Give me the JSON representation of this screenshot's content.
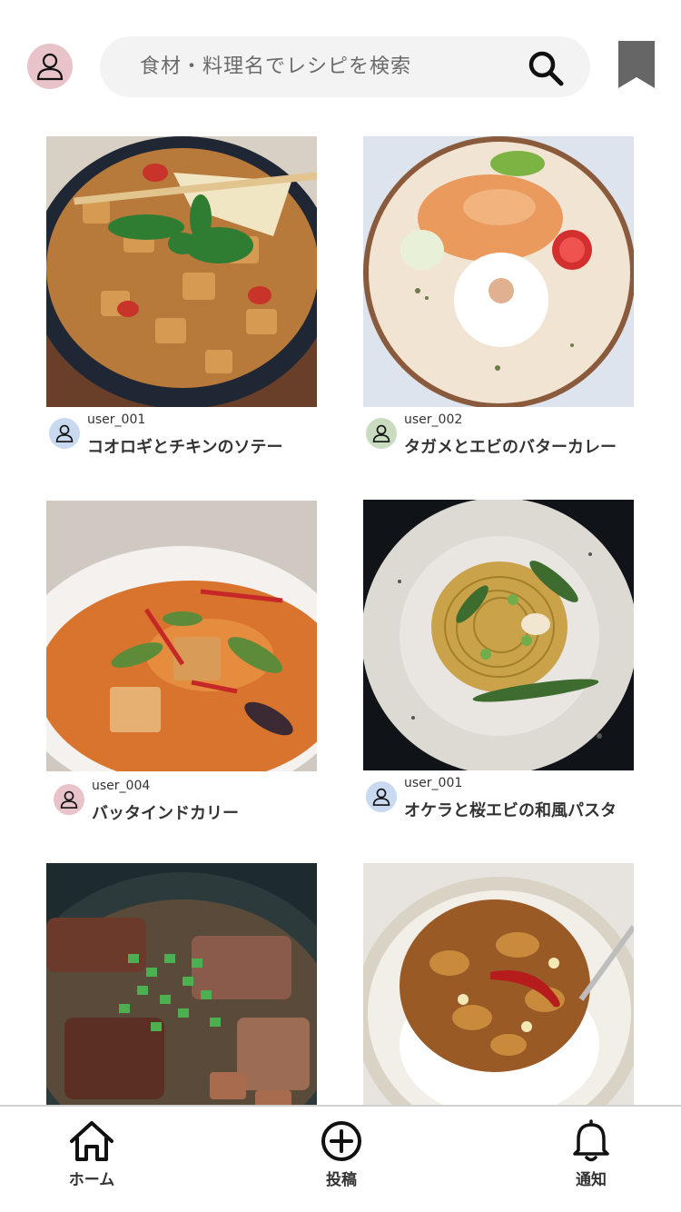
{
  "header": {
    "search_placeholder": "食材・料理名でレシピを検索",
    "avatar_icon": "user-icon",
    "search_icon": "search-icon",
    "bookmark_icon": "bookmark-icon",
    "avatar_color": "#e8c4ca",
    "bookmark_color": "#666666"
  },
  "posts": [
    {
      "user": "user_001",
      "title": "コオロギとチキンのソテー",
      "avatar_color": "#c9d9ef"
    },
    {
      "user": "user_002",
      "title": "タガメとエビのバターカレー",
      "avatar_color": "#c9dcc0"
    },
    {
      "user": "user_004",
      "title": "バッタインドカリー",
      "avatar_color": "#e8c4ca"
    },
    {
      "user": "user_001",
      "title": "オケラと桜エビの和風パスタ",
      "avatar_color": "#c9d9ef"
    },
    {
      "user": "",
      "title": ""
    },
    {
      "user": "",
      "title": ""
    }
  ],
  "nav": {
    "home": "ホーム",
    "post": "投稿",
    "notify": "通知"
  }
}
